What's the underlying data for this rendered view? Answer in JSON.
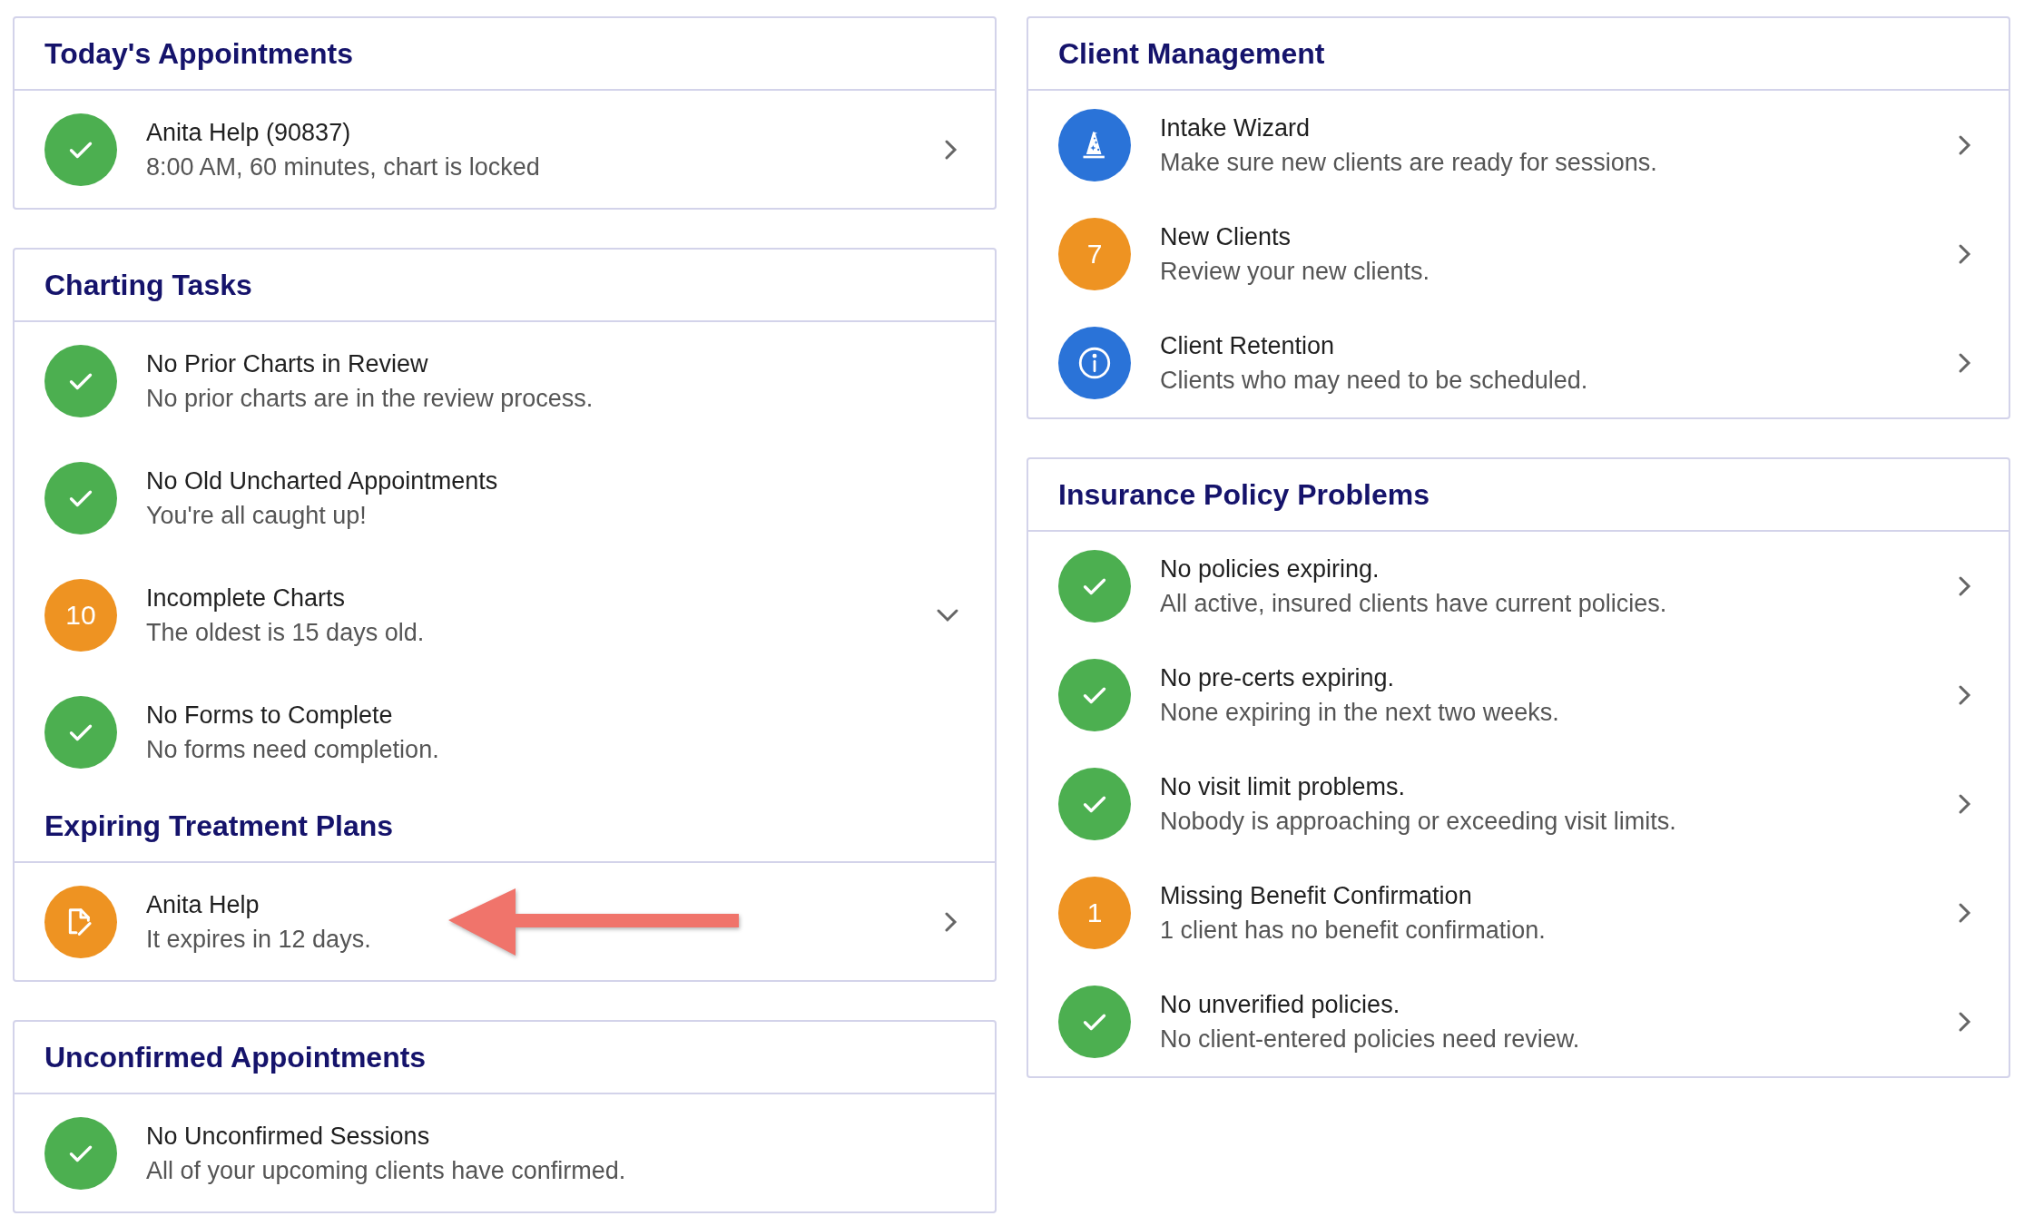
{
  "columns": [
    {
      "cards": [
        {
          "groups": [
            {
              "heading": "Today's Appointments",
              "rows": [
                {
                  "kind": "check",
                  "color": "#4caf50",
                  "title": "Anita Help (90837)",
                  "subtitle": "8:00 AM, 60 minutes, chart is locked",
                  "navigable": true
                }
              ]
            }
          ]
        },
        {
          "groups": [
            {
              "heading": "Charting Tasks",
              "rows": [
                {
                  "kind": "check",
                  "color": "#4caf50",
                  "title": "No Prior Charts in Review",
                  "subtitle": "No prior charts are in the review process.",
                  "navigable": false
                },
                {
                  "kind": "check",
                  "color": "#4caf50",
                  "title": "No Old Uncharted Appointments",
                  "subtitle": "You're all caught up!",
                  "navigable": false
                },
                {
                  "kind": "count",
                  "badge": "10",
                  "color": "#ee9322",
                  "title": "Incomplete Charts",
                  "subtitle": "The oldest is 15 days old.",
                  "expanded": false
                },
                {
                  "kind": "check",
                  "color": "#4caf50",
                  "title": "No Forms to Complete",
                  "subtitle": "No forms need completion.",
                  "navigable": false
                }
              ]
            },
            {
              "heading": "Expiring Treatment Plans",
              "rows": [
                {
                  "kind": "document",
                  "color": "#ee9322",
                  "title": "Anita Help",
                  "subtitle": "It expires in 12 days.",
                  "navigable": true,
                  "pointer": true
                }
              ]
            }
          ]
        },
        {
          "groups": [
            {
              "heading": "Unconfirmed Appointments",
              "rows": [
                {
                  "kind": "check",
                  "color": "#4caf50",
                  "title": "No Unconfirmed Sessions",
                  "subtitle": "All of your upcoming clients have confirmed.",
                  "navigable": false
                }
              ]
            }
          ]
        }
      ]
    },
    {
      "cards": [
        {
          "groups": [
            {
              "heading": "Client Management",
              "rows": [
                {
                  "kind": "wizard",
                  "color": "#2a73d8",
                  "title": "Intake Wizard",
                  "subtitle": "Make sure new clients are ready for sessions.",
                  "navigable": true
                },
                {
                  "kind": "count",
                  "badge": "7",
                  "color": "#ee9322",
                  "title": "New Clients",
                  "subtitle": "Review your new clients.",
                  "navigable": true
                },
                {
                  "kind": "info",
                  "color": "#2a73d8",
                  "title": "Client Retention",
                  "subtitle": "Clients who may need to be scheduled.",
                  "navigable": true
                }
              ]
            }
          ]
        },
        {
          "groups": [
            {
              "heading": "Insurance Policy Problems",
              "rows": [
                {
                  "kind": "check",
                  "color": "#4caf50",
                  "title": "No policies expiring.",
                  "subtitle": "All active, insured clients have current policies.",
                  "navigable": true
                },
                {
                  "kind": "check",
                  "color": "#4caf50",
                  "title": "No pre-certs expiring.",
                  "subtitle": "None expiring in the next two weeks.",
                  "navigable": true
                },
                {
                  "kind": "check",
                  "color": "#4caf50",
                  "title": "No visit limit problems.",
                  "subtitle": "Nobody is approaching or exceeding visit limits.",
                  "navigable": true
                },
                {
                  "kind": "count",
                  "badge": "1",
                  "color": "#ee9322",
                  "title": "Missing Benefit Confirmation",
                  "subtitle": "1 client has no benefit confirmation.",
                  "navigable": true
                },
                {
                  "kind": "check",
                  "color": "#4caf50",
                  "title": "No unverified policies.",
                  "subtitle": "No client-entered policies need review.",
                  "navigable": true
                }
              ]
            }
          ]
        }
      ]
    }
  ]
}
